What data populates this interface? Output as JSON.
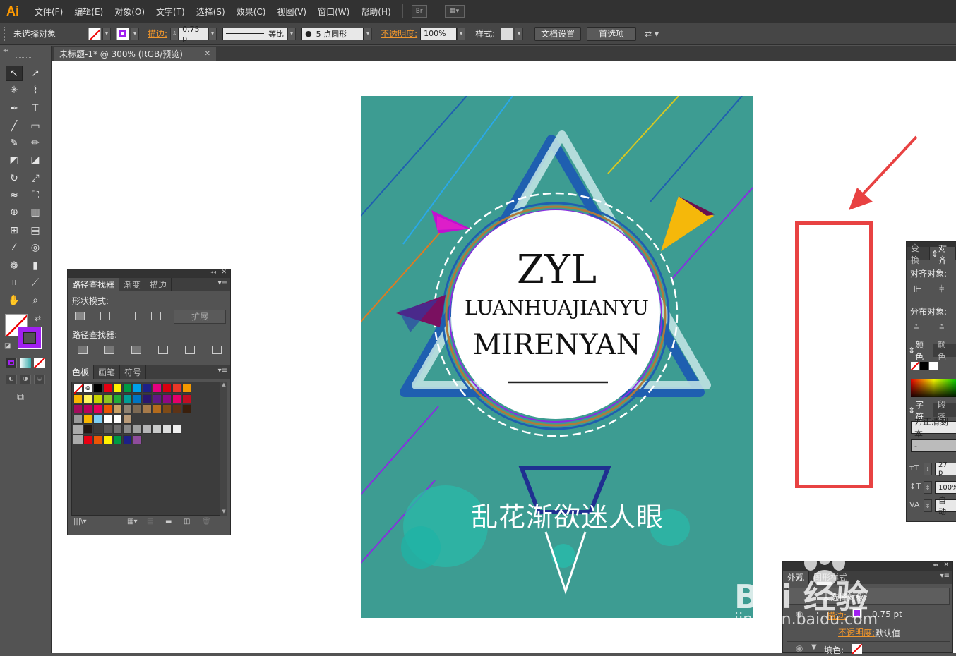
{
  "app": {
    "logo": "Ai"
  },
  "menu": [
    "文件(F)",
    "编辑(E)",
    "对象(O)",
    "文字(T)",
    "选择(S)",
    "效果(C)",
    "视图(V)",
    "窗口(W)",
    "帮助(H)"
  ],
  "menubar_icons": {
    "bridge": "Br"
  },
  "control": {
    "selection_status": "未选择对象",
    "stroke_label": "描边:",
    "stroke_weight": "0.75 p",
    "stroke_profile": "等比",
    "brush": "5 点圆形",
    "opacity_label": "不透明度:",
    "opacity_value": "100%",
    "style_label": "样式:",
    "doc_setup": "文档设置",
    "preferences": "首选项"
  },
  "document_tab": {
    "title": "未标题-1* @ 300% (RGB/预览)"
  },
  "pathfinder_panel": {
    "tabs": [
      "路径查找器",
      "渐变",
      "描边"
    ],
    "shape_modes_label": "形状模式:",
    "expand_button": "扩展",
    "pathfinders_label": "路径查找器:"
  },
  "swatches_panel": {
    "tabs": [
      "色板",
      "画笔",
      "符号"
    ],
    "row1": [
      "#ffffff",
      "#ffffff",
      "#000000",
      "#e60012",
      "#fff100",
      "#009944",
      "#00a0e9",
      "#1d2088",
      "#e4007f",
      "#d7000f",
      "#e83828",
      "#f39800"
    ],
    "row2": [
      "#f8b500",
      "#fff45c",
      "#c9d400",
      "#8fc31f",
      "#22ac38",
      "#009e96",
      "#0075c2",
      "#29166f",
      "#601986",
      "#920783",
      "#e5006a",
      "#c30d23"
    ],
    "row3": [
      "#a40b5d",
      "#b8005c",
      "#e4005a",
      "#ea5404",
      "#c9a063",
      "#8f8271",
      "#7d6a54",
      "#a67a4a",
      "#b36b1d",
      "#7f4b17",
      "#5e3316",
      "#3a1f0c"
    ],
    "row4": [
      "#999999",
      "#f8b500",
      "#7ecef4",
      "#ffffff",
      "#ffffff",
      "#b89a78"
    ],
    "row5": [
      "#231815",
      "#3e3a39",
      "#595757",
      "#727171",
      "#898989",
      "#9fa0a0",
      "#b5b5b6",
      "#c9caca",
      "#dcdddd",
      "#efefef"
    ],
    "row6": [
      "#e60012",
      "#ea5504",
      "#fff100",
      "#009944",
      "#1d2088",
      "#8f4c9c"
    ]
  },
  "artboard": {
    "title_large": "ZYL",
    "title_line2": "LUANHUAJIANYU",
    "title_line3": "MIRENYAN",
    "chinese_caption": "乱花渐欲迷人眼"
  },
  "right_panel": {
    "tabs_top": [
      "变换",
      "对齐"
    ],
    "align_objects_label": "对齐对象:",
    "distribute_objects_label": "分布对象:",
    "color_tabs": [
      "颜色",
      "颜色"
    ],
    "char_tabs": [
      "字符",
      "段落"
    ],
    "font_family": "方正清刻本",
    "font_style": "-",
    "font_size": "27 p",
    "leading": "100%",
    "tracking": "自动"
  },
  "appearance_panel": {
    "tabs": [
      "外观",
      "图形样式"
    ],
    "status": "未选择对象",
    "stroke_label": "描边:",
    "stroke_value": "0.75 pt",
    "opacity_label": "不透明度:",
    "opacity_value": "默认值",
    "fill_label": "填色:"
  },
  "watermark": {
    "line1": "Bai 经验",
    "line2": "jingyan.baidu.com"
  },
  "colors": {
    "artboard_bg": "#3d9c92",
    "highlight_rect": "#e84242",
    "accent_orange": "#f0962c",
    "stroke_purple": "#9c27e0"
  }
}
